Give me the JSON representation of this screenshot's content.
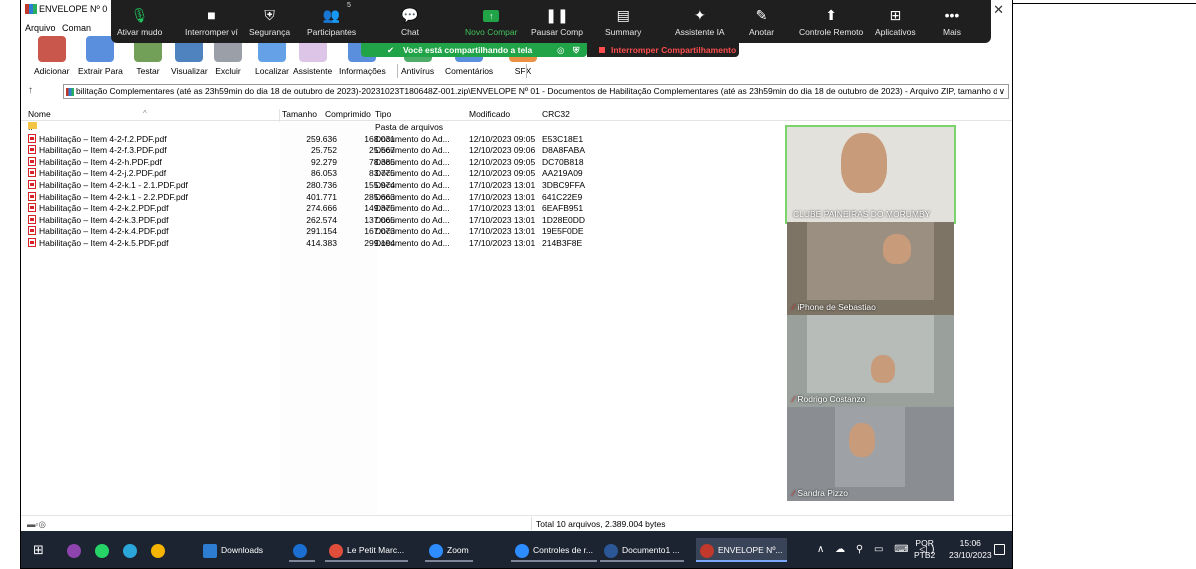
{
  "window": {
    "title": "ENVELOPE Nº 0",
    "close": "✕"
  },
  "menu": [
    "Arquivo",
    "Coman"
  ],
  "zoom_bar": {
    "items": [
      {
        "icon": "mic-icon",
        "glyph": "🎙",
        "label": "Ativar mudo"
      },
      {
        "icon": "video-icon",
        "glyph": "■",
        "label": "Interromper ví"
      },
      {
        "icon": "shield-icon",
        "glyph": "⛨",
        "label": "Segurança"
      },
      {
        "icon": "participants-icon",
        "glyph": "👥",
        "label": "Participantes"
      },
      {
        "icon": "chat-icon",
        "glyph": "💬",
        "label": "Chat"
      },
      {
        "icon": "share-screen-icon",
        "glyph": "↑",
        "label": "Novo Compar"
      },
      {
        "icon": "pause-icon",
        "glyph": "❚❚",
        "label": "Pausar Comp"
      },
      {
        "icon": "summary-icon",
        "glyph": "▤",
        "label": "Summary"
      },
      {
        "icon": "ai-assistant-icon",
        "glyph": "✦",
        "label": "Assistente IA"
      },
      {
        "icon": "annotate-icon",
        "glyph": "✎",
        "label": "Anotar"
      },
      {
        "icon": "remote-control-icon",
        "glyph": "⬆",
        "label": "Controle Remoto"
      },
      {
        "icon": "apps-icon",
        "glyph": "⊞",
        "label": "Aplicativos"
      },
      {
        "icon": "more-icon",
        "glyph": "•••",
        "label": "Mais"
      }
    ],
    "participants_count": "5",
    "sharing_text": "Você está compartilhando a tela",
    "stop_share": "Interromper Compartilhamento"
  },
  "toolbar": [
    {
      "label": "Adicionar",
      "color": "#c0392b"
    },
    {
      "label": "Extrair Para",
      "color": "#3d7bd8"
    },
    {
      "label": "Testar",
      "color": "#5a8f3c"
    },
    {
      "label": "Visualizar",
      "color": "#2f6db5"
    },
    {
      "label": "Excluir",
      "color": "#8a8f99"
    },
    {
      "label": "Localizar",
      "color": "#4a90e2"
    },
    {
      "label": "Assistente",
      "color": "#9b59b6"
    },
    {
      "label": "Informações",
      "color": "#3d7bd8"
    },
    {
      "label": "Antivírus",
      "color": "#2e9e4d"
    },
    {
      "label": "Comentários",
      "color": "#3d7bd8"
    },
    {
      "label": "SFX",
      "color": "#e67e22"
    }
  ],
  "address": "bilitação Complementares (até as 23h59min do dia 18 de outubro de 2023)-20231023T180648Z-001.zip\\ENVELOPE Nº 01 - Documentos de Habilitação Complementares (até as 23h59min do dia 18 de outubro de 2023) - Arquivo ZIP, tamanho d",
  "address_chevron": "∨",
  "columns": {
    "name": "Nome",
    "size": "Tamanho",
    "packed": "Comprimido",
    "type": "Tipo",
    "modified": "Modificado",
    "crc": "CRC32"
  },
  "rows": [
    {
      "name": "..",
      "size": "",
      "packed": "",
      "type": "Pasta de arquivos",
      "modified": "",
      "crc": "",
      "folder": true
    },
    {
      "name": "Habilitação – Item 4-2-f.2.PDF.pdf",
      "size": "259.636",
      "packed": "168.031",
      "type": "Documento do Ad...",
      "modified": "12/10/2023 09:05",
      "crc": "E53C18E1"
    },
    {
      "name": "Habilitação – Item 4-2-f.3.PDF.pdf",
      "size": "25.752",
      "packed": "25.567",
      "type": "Documento do Ad...",
      "modified": "12/10/2023 09:06",
      "crc": "D8A8FABA"
    },
    {
      "name": "Habilitação – Item 4-2-h.PDF.pdf",
      "size": "92.279",
      "packed": "78.385",
      "type": "Documento do Ad...",
      "modified": "12/10/2023 09:05",
      "crc": "DC70B818"
    },
    {
      "name": "Habilitação – Item 4-2-j.2.PDF.pdf",
      "size": "86.053",
      "packed": "83.775",
      "type": "Documento do Ad...",
      "modified": "12/10/2023 09:05",
      "crc": "AA219A09"
    },
    {
      "name": "Habilitação – Item 4-2-k.1 - 2.1.PDF.pdf",
      "size": "280.736",
      "packed": "155.974",
      "type": "Documento do Ad...",
      "modified": "17/10/2023 13:01",
      "crc": "3DBC9FFA"
    },
    {
      "name": "Habilitação – Item 4-2-k.1 - 2.2.PDF.pdf",
      "size": "401.771",
      "packed": "285.663",
      "type": "Documento do Ad...",
      "modified": "17/10/2023 13:01",
      "crc": "641C22E9"
    },
    {
      "name": "Habilitação – Item 4-2-k.2.PDF.pdf",
      "size": "274.666",
      "packed": "149.375",
      "type": "Documento do Ad...",
      "modified": "17/10/2023 13:01",
      "crc": "6EAFB951"
    },
    {
      "name": "Habilitação – Item 4-2-k.3.PDF.pdf",
      "size": "262.574",
      "packed": "137.065",
      "type": "Documento do Ad...",
      "modified": "17/10/2023 13:01",
      "crc": "1D28E0DD"
    },
    {
      "name": "Habilitação – Item 4-2-k.4.PDF.pdf",
      "size": "291.154",
      "packed": "167.073",
      "type": "Documento do Ad...",
      "modified": "17/10/2023 13:01",
      "crc": "19E5F0DE"
    },
    {
      "name": "Habilitação – Item 4-2-k.5.PDF.pdf",
      "size": "414.383",
      "packed": "299.194",
      "type": "Documento do Ad...",
      "modified": "17/10/2023 13:01",
      "crc": "214B3F8E"
    }
  ],
  "status": {
    "total": "Total 10 arquivos, 2.389.004 bytes"
  },
  "participants": [
    {
      "name": "CLUBE PAINEIRAS DO MORUMBY",
      "muted": false,
      "bg": "#d9d6cf",
      "active": true
    },
    {
      "name": "iPhone de Sebastiao",
      "muted": true,
      "bg": "#7d7466"
    },
    {
      "name": "Rodrigo Costanzo",
      "muted": true,
      "bg": "#9aa19c"
    },
    {
      "name": "Sandra Pizzo",
      "muted": true,
      "bg": "#8a8e92"
    }
  ],
  "taskbar": {
    "items": [
      {
        "label": "Downloads",
        "icon": "folder-icon",
        "color": "#2d7dd2"
      },
      {
        "label": "",
        "icon": "outlook-icon",
        "color": "#1a6fd1"
      },
      {
        "label": "Le Petit Marc...",
        "icon": "chrome-icon",
        "color": "#e04d3b"
      },
      {
        "label": "Zoom",
        "icon": "zoom-icon",
        "color": "#2d8cff"
      },
      {
        "label": "Controles de r...",
        "icon": "zoom-icon",
        "color": "#2d8cff"
      },
      {
        "label": "Documento1 ...",
        "icon": "word-icon",
        "color": "#2b5797"
      },
      {
        "label": "ENVELOPE Nº...",
        "icon": "winrar-icon",
        "color": "#c0392b"
      }
    ],
    "lang": [
      "POR",
      "PTB2"
    ],
    "time": "15:06",
    "date": "23/10/2023"
  }
}
